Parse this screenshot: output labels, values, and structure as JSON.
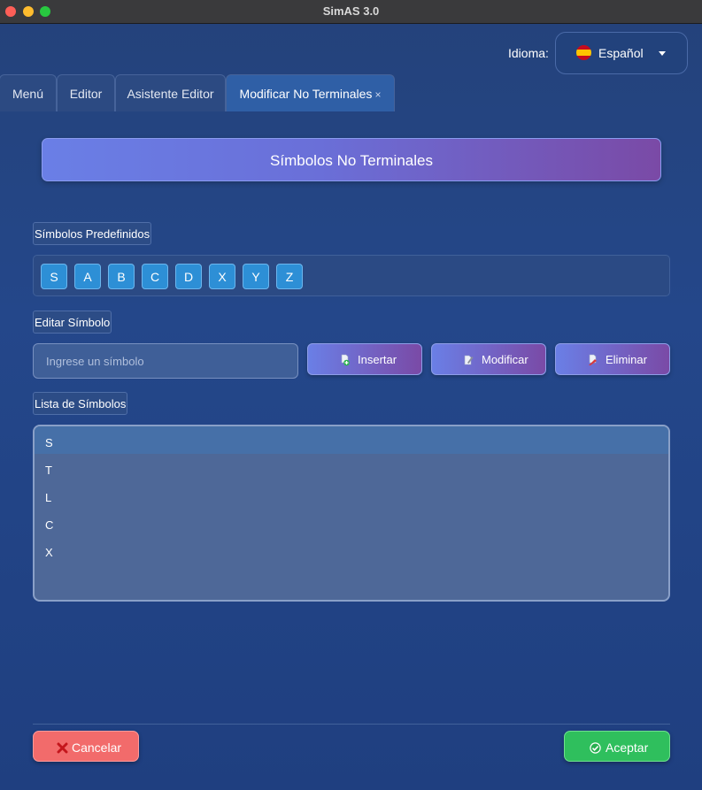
{
  "window": {
    "title": "SimAS 3.0"
  },
  "language": {
    "label": "Idioma:",
    "selected": "Español",
    "flag_icon": "spain-flag-icon"
  },
  "tabs": [
    {
      "label": "Menú",
      "active": false
    },
    {
      "label": "Editor",
      "active": false
    },
    {
      "label": "Asistente Editor",
      "active": false
    },
    {
      "label": "Modificar No Terminales",
      "active": true,
      "close": "×"
    }
  ],
  "header": {
    "title": "Símbolos No Terminales"
  },
  "predefined": {
    "label": "Símbolos Predefinidos",
    "symbols": [
      "S",
      "A",
      "B",
      "C",
      "D",
      "X",
      "Y",
      "Z"
    ]
  },
  "edit": {
    "label": "Editar Símbolo",
    "input_placeholder": "Ingrese un símbolo",
    "input_value": "",
    "insert_label": "Insertar",
    "modify_label": "Modificar",
    "delete_label": "Eliminar"
  },
  "list": {
    "label": "Lista de Símbolos",
    "items": [
      "S",
      "T",
      "L",
      "C",
      "X"
    ],
    "selected_index": 0
  },
  "footer": {
    "cancel_label": "Cancelar",
    "accept_label": "Aceptar"
  },
  "colors": {
    "accent_gradient_start": "#6a7fe6",
    "accent_gradient_end": "#7a4aa6",
    "cancel": "#f26b6b",
    "accept": "#2fbf5d",
    "symbol_button": "#2d8fd6"
  }
}
